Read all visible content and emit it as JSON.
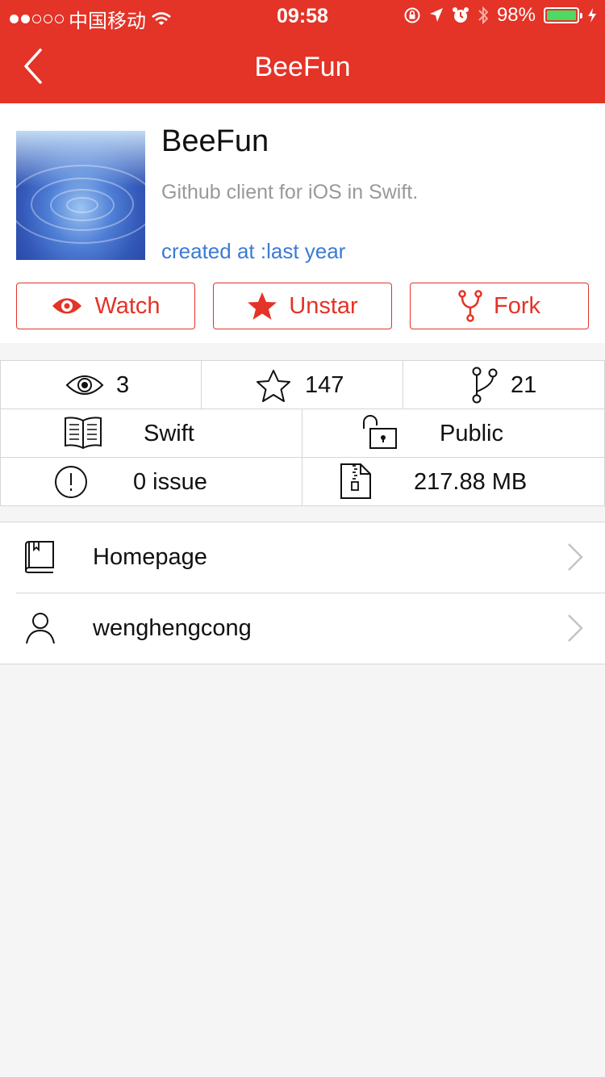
{
  "status_bar": {
    "carrier": "中国移动",
    "time": "09:58",
    "battery": "98%"
  },
  "nav": {
    "title": "BeeFun"
  },
  "repo": {
    "name": "BeeFun",
    "description": "Github client for iOS in Swift.",
    "created": "created at :last year"
  },
  "actions": {
    "watch": "Watch",
    "unstar": "Unstar",
    "fork": "Fork"
  },
  "stats": {
    "watchers": "3",
    "stars": "147",
    "forks": "21",
    "language": "Swift",
    "visibility": "Public",
    "issues": "0 issue",
    "size": "217.88 MB"
  },
  "links": {
    "homepage": "Homepage",
    "owner": "wenghengcong"
  },
  "colors": {
    "brand": "#e43327",
    "link": "#3a7bd5",
    "battery": "#4cd964"
  }
}
